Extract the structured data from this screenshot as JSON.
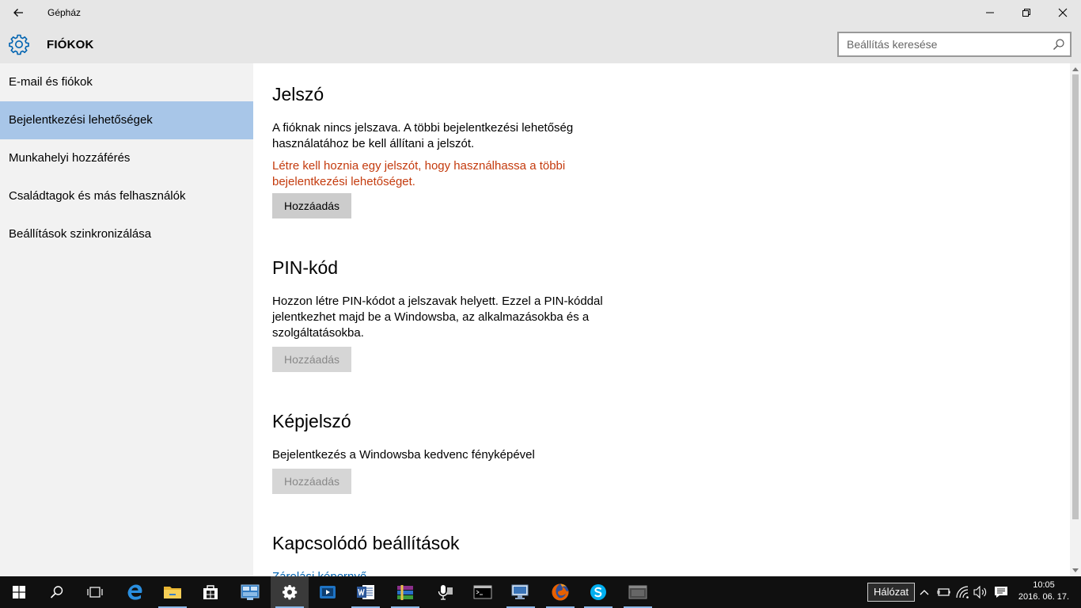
{
  "window": {
    "title": "Gépház"
  },
  "header": {
    "title": "FIÓKOK",
    "search_placeholder": "Beállítás keresése"
  },
  "sidebar": {
    "items": [
      {
        "label": "E-mail és fiókok"
      },
      {
        "label": "Bejelentkezési lehetőségek"
      },
      {
        "label": "Munkahelyi hozzáférés"
      },
      {
        "label": "Családtagok és más felhasználók"
      },
      {
        "label": "Beállítások szinkronizálása"
      }
    ]
  },
  "main": {
    "password": {
      "title": "Jelszó",
      "description": "A fióknak nincs jelszava. A többi bejelentkezési lehetőség használatához be kell állítani a jelszót.",
      "warning": "Létre kell hoznia egy jelszót, hogy használhassa a többi bejelentkezési lehetőséget.",
      "button_label": "Hozzáadás"
    },
    "pin": {
      "title": "PIN-kód",
      "description": "Hozzon létre PIN-kódot a jelszavak helyett. Ezzel a PIN-kóddal jelentkezhet majd be a Windowsba, az alkalmazásokba és a szolgáltatásokba.",
      "button_label": "Hozzáadás"
    },
    "picture_password": {
      "title": "Képjelszó",
      "description": "Bejelentkezés a Windowsba kedvenc fényképével",
      "button_label": "Hozzáadás"
    },
    "related": {
      "title": "Kapcsolódó beállítások",
      "link_label": "Zárolási képernyő"
    }
  },
  "taskbar": {
    "network_tooltip": "Hálózat",
    "time": "10:05",
    "date": "2016. 06. 17."
  },
  "colors": {
    "accent": "#0063b1",
    "warning": "#c43b0e",
    "selected_nav": "#a8c6e8",
    "chrome": "#e6e6e6"
  }
}
